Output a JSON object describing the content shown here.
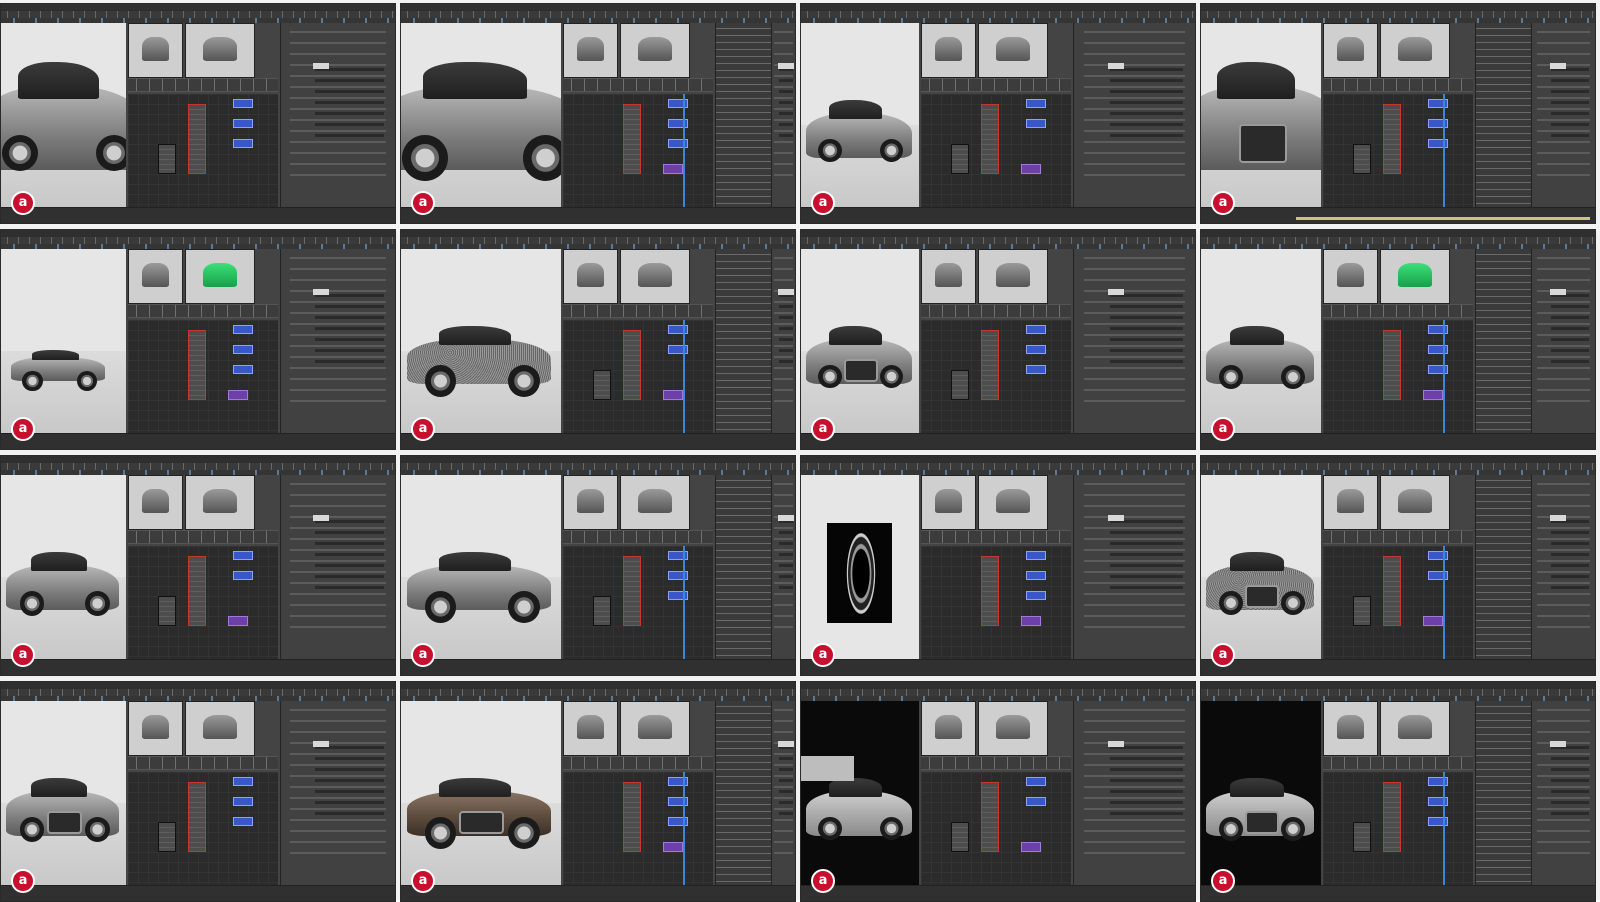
{
  "sheet": {
    "columns": 4,
    "rows": 4,
    "app_theme": "#444444",
    "accent_blue": "#3a86d8",
    "logo_color": "#c8102e",
    "logo_icon": "red-circle-a-logo",
    "logo_glyph": "a"
  },
  "tiles": [
    {
      "id": 1,
      "viewport": "car-side-closeup",
      "preview": "grey"
    },
    {
      "id": 2,
      "viewport": "car-rear-closeup",
      "preview": "grey"
    },
    {
      "id": 3,
      "viewport": "car-full-side",
      "preview": "grey"
    },
    {
      "id": 4,
      "viewport": "car-front-grille",
      "preview": "grey"
    },
    {
      "id": 5,
      "viewport": "car-small-full",
      "preview": "green"
    },
    {
      "id": 6,
      "viewport": "car-noisy-side",
      "preview": "grey"
    },
    {
      "id": 7,
      "viewport": "car-front-headlight",
      "preview": "grey"
    },
    {
      "id": 8,
      "viewport": "car-front-3q",
      "preview": "green"
    },
    {
      "id": 9,
      "viewport": "car-side-3q",
      "preview": "grey"
    },
    {
      "id": 10,
      "viewport": "car-full-3q",
      "preview": "grey"
    },
    {
      "id": 11,
      "viewport": "tire-render",
      "preview": "grey"
    },
    {
      "id": 12,
      "viewport": "car-noisy-front",
      "preview": "grey"
    },
    {
      "id": 13,
      "viewport": "car-full-front",
      "preview": "grey"
    },
    {
      "id": 14,
      "viewport": "car-brown-front",
      "preview": "grey"
    },
    {
      "id": 15,
      "viewport": "car-dark-mask",
      "preview": "grey"
    },
    {
      "id": 16,
      "viewport": "car-front-dark",
      "preview": "grey"
    }
  ]
}
